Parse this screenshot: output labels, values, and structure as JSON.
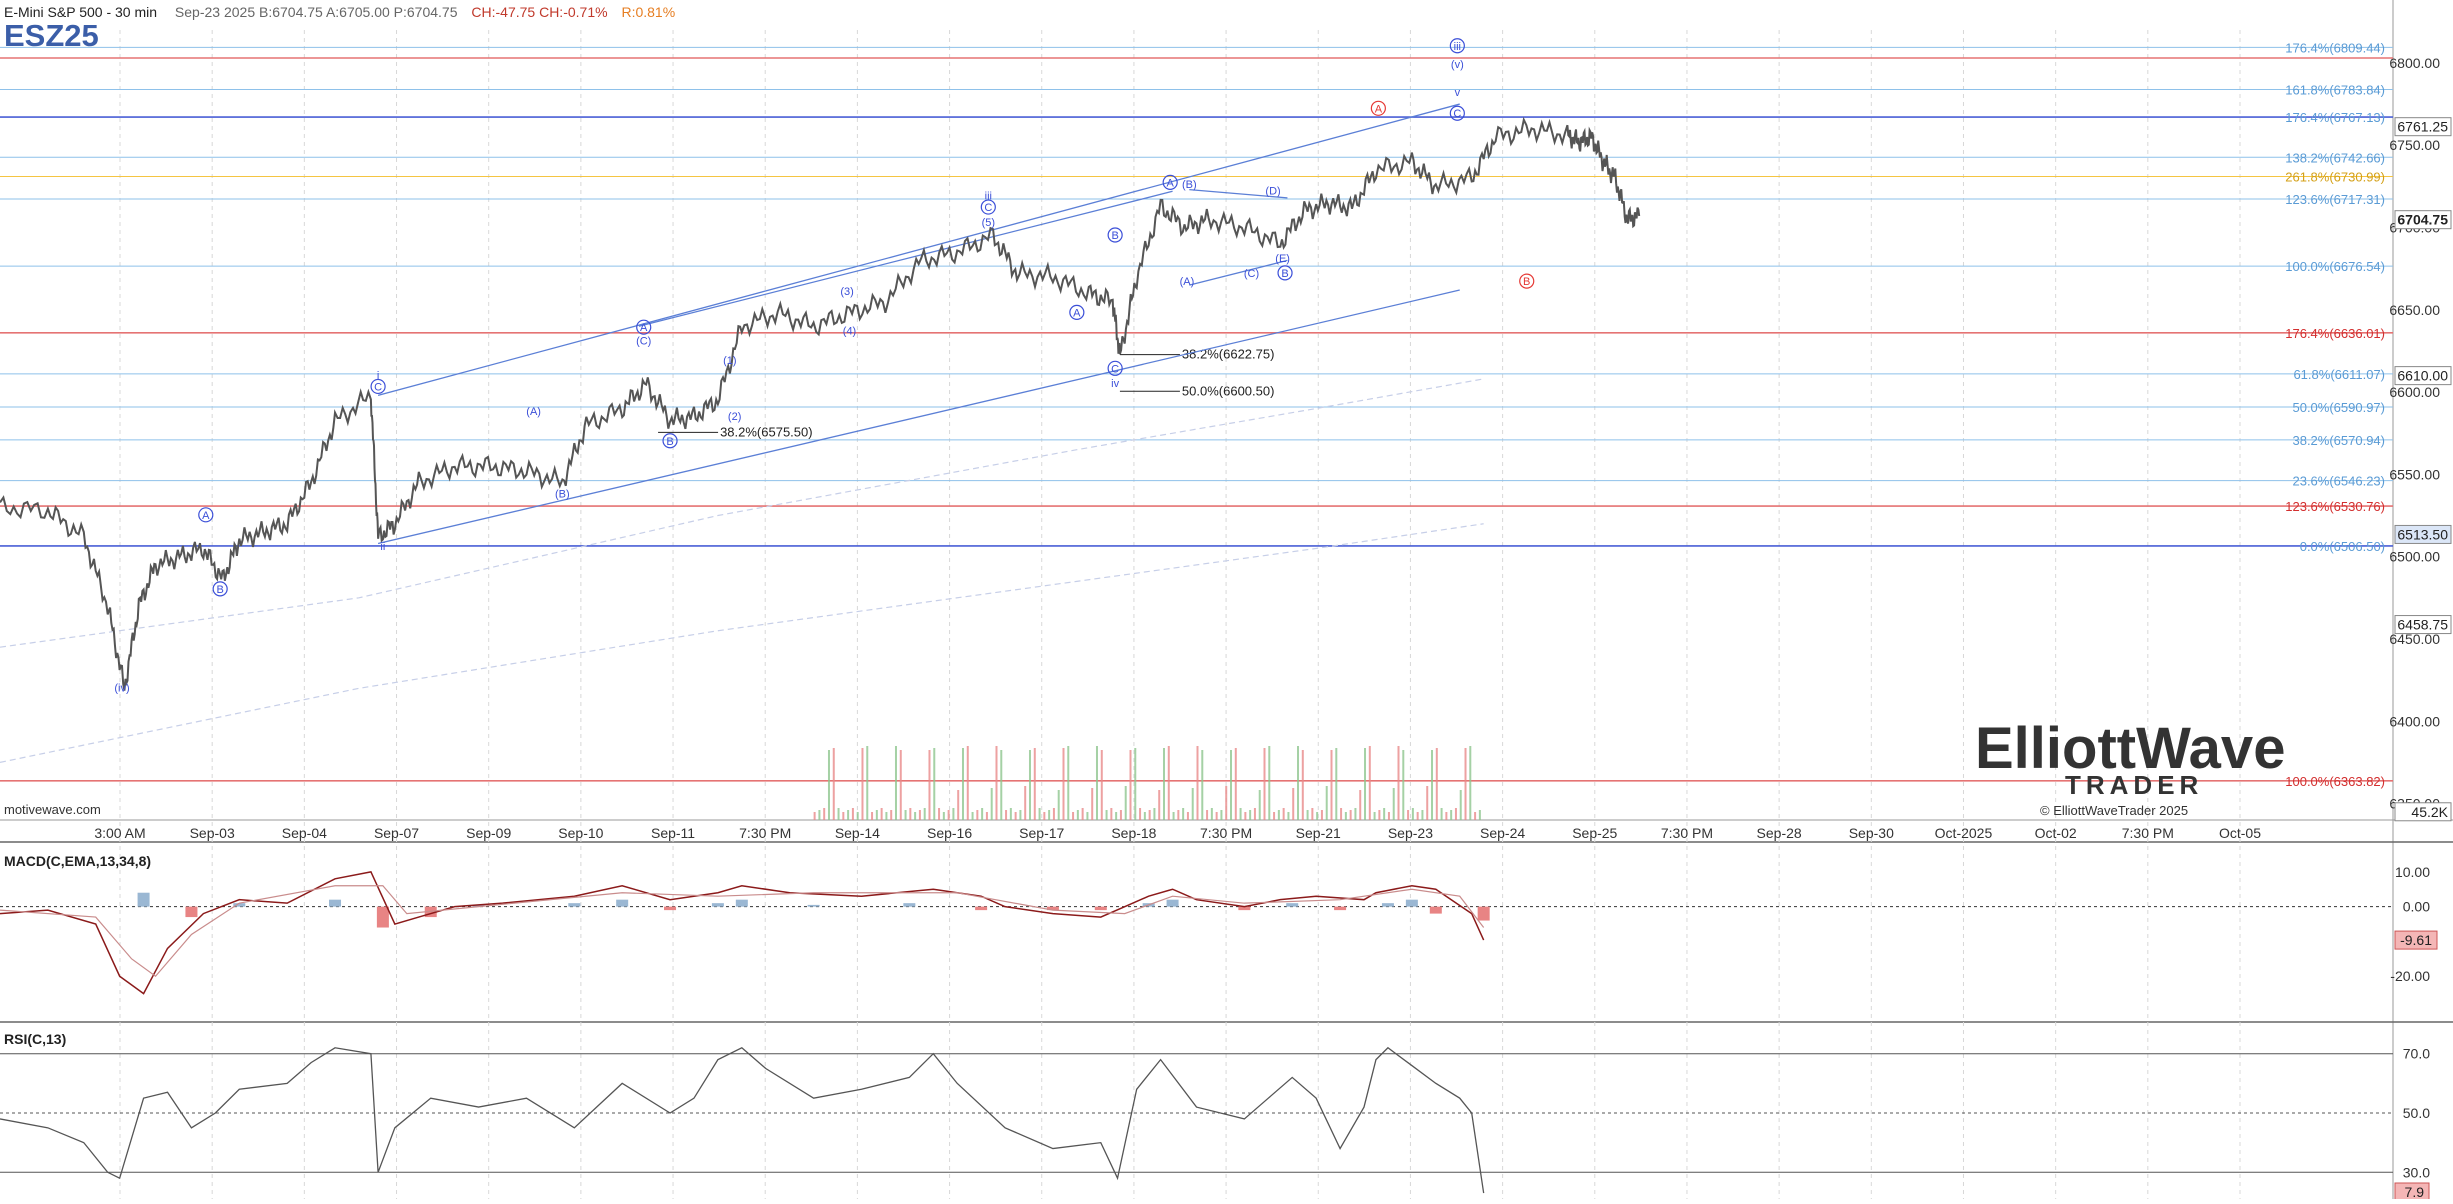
{
  "header": {
    "title": "E-Mini S&P 500 - 30 min",
    "quote": "Sep-23 2025  B:6704.75  A:6705.00  P:6704.75",
    "change": "CH:-47.75  CH:-0.71%",
    "range": "R:0.81%",
    "symbol": "ESZ25"
  },
  "watermark": {
    "source": "motivewave.com",
    "copyright": "© ElliottWaveTrader 2025",
    "logo_top": "ElliottWave",
    "logo_bottom": "TRADER"
  },
  "colors": {
    "price": "#555555",
    "fib_blue": "#8ec1ea",
    "fib_red": "#e57373",
    "channel": "#5b7fd6",
    "wave": "#3b4fd8",
    "wave_red": "#e53935",
    "macd_pos": "#9ab7d3",
    "macd_neg": "#e88484",
    "rsi": "#555555",
    "yellow": "#f5c542"
  },
  "chart_data": [
    {
      "type": "line",
      "title": "E-Mini S&P 500 - 30 min",
      "ylim": [
        6340,
        6820
      ],
      "y_ticks": [
        6800,
        6750,
        6700,
        6650,
        6600,
        6550,
        6500,
        6450,
        6400,
        6350
      ],
      "y_tick_labels": [
        "6800.00",
        "6750.00",
        "6700.00",
        "6650.00",
        "6600.00",
        "6550.00",
        "6500.00",
        "6450.00",
        "6400.00",
        "6350.00"
      ],
      "x_labels": [
        "3:00 AM",
        "Sep-03",
        "Sep-04",
        "Sep-07",
        "Sep-09",
        "Sep-10",
        "Sep-11",
        "7:30 PM",
        "Sep-14",
        "Sep-16",
        "Sep-17",
        "Sep-18",
        "7:30 PM",
        "Sep-21",
        "Sep-23",
        "Sep-24",
        "Sep-25",
        "7:30 PM",
        "Sep-28",
        "Sep-30",
        "Oct-2025",
        "Oct-02",
        "7:30 PM",
        "Oct-05"
      ],
      "price_path": [
        [
          0,
          6530
        ],
        [
          0.02,
          6528
        ],
        [
          0.035,
          6512
        ],
        [
          0.045,
          6470
        ],
        [
          0.052,
          6420
        ],
        [
          0.058,
          6470
        ],
        [
          0.065,
          6495
        ],
        [
          0.075,
          6500
        ],
        [
          0.085,
          6505
        ],
        [
          0.093,
          6486
        ],
        [
          0.1,
          6510
        ],
        [
          0.11,
          6515
        ],
        [
          0.12,
          6520
        ],
        [
          0.13,
          6545
        ],
        [
          0.14,
          6582
        ],
        [
          0.155,
          6598
        ],
        [
          0.158,
          6512
        ],
        [
          0.165,
          6520
        ],
        [
          0.175,
          6545
        ],
        [
          0.19,
          6555
        ],
        [
          0.205,
          6555
        ],
        [
          0.22,
          6552
        ],
        [
          0.235,
          6545
        ],
        [
          0.245,
          6580
        ],
        [
          0.26,
          6590
        ],
        [
          0.27,
          6605
        ],
        [
          0.28,
          6583
        ],
        [
          0.29,
          6585
        ],
        [
          0.3,
          6595
        ],
        [
          0.31,
          6640
        ],
        [
          0.325,
          6648
        ],
        [
          0.34,
          6640
        ],
        [
          0.355,
          6648
        ],
        [
          0.37,
          6655
        ],
        [
          0.385,
          6680
        ],
        [
          0.4,
          6685
        ],
        [
          0.415,
          6695
        ],
        [
          0.425,
          6672
        ],
        [
          0.44,
          6670
        ],
        [
          0.455,
          6660
        ],
        [
          0.465,
          6655
        ],
        [
          0.468,
          6622
        ],
        [
          0.475,
          6670
        ],
        [
          0.485,
          6713
        ],
        [
          0.495,
          6700
        ],
        [
          0.505,
          6705
        ],
        [
          0.52,
          6700
        ],
        [
          0.535,
          6690
        ],
        [
          0.545,
          6710
        ],
        [
          0.555,
          6715
        ],
        [
          0.565,
          6712
        ],
        [
          0.575,
          6735
        ],
        [
          0.59,
          6740
        ],
        [
          0.6,
          6725
        ],
        [
          0.615,
          6730
        ],
        [
          0.625,
          6755
        ],
        [
          0.64,
          6760
        ],
        [
          0.655,
          6756
        ],
        [
          0.66,
          6752
        ],
        [
          0.665,
          6755
        ],
        [
          0.67,
          6740
        ],
        [
          0.675,
          6730
        ],
        [
          0.68,
          6705
        ],
        [
          0.685,
          6707
        ]
      ],
      "fib_right": [
        {
          "label": "176.4%(6809.44)",
          "value": 6809.44,
          "color": "blue"
        },
        {
          "label": "161.8%(6783.84)",
          "value": 6783.84,
          "color": "blue"
        },
        {
          "label": "176.4%(6767.13)",
          "value": 6767.13,
          "color": "blue"
        },
        {
          "label": "138.2%(6742.66)",
          "value": 6742.66,
          "color": "blue"
        },
        {
          "label": "261.8%(6730.99)",
          "value": 6730.99,
          "color": "yellow"
        },
        {
          "label": "123.6%(6717.31)",
          "value": 6717.31,
          "color": "blue"
        },
        {
          "label": "100.0%(6676.54)",
          "value": 6676.54,
          "color": "blue"
        },
        {
          "label": "176.4%(6636.01)",
          "value": 6636.01,
          "color": "red"
        },
        {
          "label": "61.8%(6611.07)",
          "value": 6611.07,
          "color": "blue"
        },
        {
          "label": "50.0%(6590.97)",
          "value": 6590.97,
          "color": "blue"
        },
        {
          "label": "38.2%(6570.94)",
          "value": 6570.94,
          "color": "blue"
        },
        {
          "label": "23.6%(6546.23)",
          "value": 6546.23,
          "color": "blue"
        },
        {
          "label": "123.6%(6530.76)",
          "value": 6530.76,
          "color": "red"
        },
        {
          "label": "0.0%(6506.50)",
          "value": 6506.5,
          "color": "blue"
        },
        {
          "label": "100.0%(6363.82)",
          "value": 6363.82,
          "color": "red"
        }
      ],
      "fib_inline": [
        {
          "label": "38.2%(6575.50)",
          "value": 6575.5
        },
        {
          "label": "38.2%(6622.75)",
          "value": 6622.75
        },
        {
          "label": "50.0%(6600.50)",
          "value": 6600.5
        }
      ],
      "price_tags": [
        {
          "label": "6761.25",
          "value": 6761.25
        },
        {
          "label": "6704.75",
          "value": 6704.75
        },
        {
          "label": "6610.00",
          "value": 6610
        },
        {
          "label": "6513.50",
          "value": 6513.5
        },
        {
          "label": "6458.75",
          "value": 6458.75
        },
        {
          "label": "45.2K",
          "value": 6345
        }
      ],
      "wave_labels": [
        {
          "t": "(iv)",
          "x": 0.051,
          "y": 6418,
          "circle": false
        },
        {
          "t": "A",
          "x": 0.086,
          "y": 6523,
          "circle": true
        },
        {
          "t": "B",
          "x": 0.092,
          "y": 6478,
          "circle": true
        },
        {
          "t": "i",
          "x": 0.158,
          "y": 6608,
          "circle": false
        },
        {
          "t": "C",
          "x": 0.158,
          "y": 6601,
          "circle": true
        },
        {
          "t": "ii",
          "x": 0.16,
          "y": 6504,
          "circle": false
        },
        {
          "t": "(A)",
          "x": 0.223,
          "y": 6586,
          "circle": false
        },
        {
          "t": "(B)",
          "x": 0.235,
          "y": 6536,
          "circle": false
        },
        {
          "t": "A",
          "x": 0.269,
          "y": 6637,
          "circle": true
        },
        {
          "t": "(C)",
          "x": 0.269,
          "y": 6629,
          "circle": false
        },
        {
          "t": "B",
          "x": 0.28,
          "y": 6568,
          "circle": true
        },
        {
          "t": "(1)",
          "x": 0.305,
          "y": 6617,
          "circle": false
        },
        {
          "t": "(2)",
          "x": 0.307,
          "y": 6583,
          "circle": false
        },
        {
          "t": "(3)",
          "x": 0.354,
          "y": 6659,
          "circle": false
        },
        {
          "t": "(4)",
          "x": 0.355,
          "y": 6635,
          "circle": false
        },
        {
          "t": "iii",
          "x": 0.413,
          "y": 6717,
          "circle": false
        },
        {
          "t": "C",
          "x": 0.413,
          "y": 6710,
          "circle": true
        },
        {
          "t": "(5)",
          "x": 0.413,
          "y": 6701,
          "circle": false
        },
        {
          "t": "A",
          "x": 0.45,
          "y": 6646,
          "circle": true
        },
        {
          "t": "B",
          "x": 0.466,
          "y": 6693,
          "circle": true
        },
        {
          "t": "C",
          "x": 0.466,
          "y": 6612,
          "circle": true
        },
        {
          "t": "iv",
          "x": 0.466,
          "y": 6603,
          "circle": false
        },
        {
          "t": "A",
          "x": 0.489,
          "y": 6725,
          "circle": true
        },
        {
          "t": "(B)",
          "x": 0.497,
          "y": 6724,
          "circle": false
        },
        {
          "t": "(A)",
          "x": 0.496,
          "y": 6665,
          "circle": false
        },
        {
          "t": "(C)",
          "x": 0.523,
          "y": 6670,
          "circle": false
        },
        {
          "t": "(D)",
          "x": 0.532,
          "y": 6720,
          "circle": false
        },
        {
          "t": "(E)",
          "x": 0.536,
          "y": 6679,
          "circle": false
        },
        {
          "t": "B",
          "x": 0.537,
          "y": 6670,
          "circle": true
        },
        {
          "t": "A",
          "x": 0.576,
          "y": 6770,
          "circle": true,
          "red": true
        },
        {
          "t": "iii",
          "x": 0.609,
          "y": 6808,
          "circle": true
        },
        {
          "t": "(v)",
          "x": 0.609,
          "y": 6797,
          "circle": false
        },
        {
          "t": "v",
          "x": 0.609,
          "y": 6780,
          "circle": false
        },
        {
          "t": "C",
          "x": 0.609,
          "y": 6767,
          "circle": true
        },
        {
          "t": "B",
          "x": 0.638,
          "y": 6665,
          "circle": true,
          "red": true
        }
      ]
    },
    {
      "type": "bar",
      "title": "MACD(C,EMA,13,34,8)",
      "ylim": [
        -32,
        18
      ],
      "y_tick_labels": [
        "10.00",
        "0.00",
        "-20.00"
      ],
      "y_ticks": [
        10,
        0,
        -20
      ],
      "current_label": "-9.61",
      "current_value": -9.61,
      "macd_line": [
        [
          0,
          -2
        ],
        [
          0.02,
          -1
        ],
        [
          0.04,
          -5
        ],
        [
          0.05,
          -20
        ],
        [
          0.06,
          -25
        ],
        [
          0.07,
          -12
        ],
        [
          0.085,
          -2
        ],
        [
          0.1,
          2
        ],
        [
          0.12,
          1
        ],
        [
          0.14,
          8
        ],
        [
          0.155,
          10
        ],
        [
          0.165,
          -5
        ],
        [
          0.175,
          -3
        ],
        [
          0.19,
          0
        ],
        [
          0.21,
          1
        ],
        [
          0.24,
          3
        ],
        [
          0.26,
          6
        ],
        [
          0.28,
          2
        ],
        [
          0.3,
          4
        ],
        [
          0.31,
          6
        ],
        [
          0.33,
          4
        ],
        [
          0.36,
          3
        ],
        [
          0.39,
          5
        ],
        [
          0.41,
          3
        ],
        [
          0.42,
          0
        ],
        [
          0.44,
          -2
        ],
        [
          0.46,
          -3
        ],
        [
          0.47,
          0
        ],
        [
          0.48,
          3
        ],
        [
          0.49,
          5
        ],
        [
          0.5,
          2
        ],
        [
          0.52,
          0
        ],
        [
          0.535,
          2
        ],
        [
          0.55,
          3
        ],
        [
          0.57,
          2
        ],
        [
          0.575,
          4
        ],
        [
          0.59,
          6
        ],
        [
          0.6,
          5
        ],
        [
          0.615,
          -2
        ],
        [
          0.62,
          -9.6
        ]
      ],
      "signal_line": [
        [
          0,
          -1
        ],
        [
          0.04,
          -3
        ],
        [
          0.055,
          -15
        ],
        [
          0.065,
          -20
        ],
        [
          0.08,
          -8
        ],
        [
          0.1,
          1
        ],
        [
          0.14,
          6
        ],
        [
          0.16,
          6
        ],
        [
          0.17,
          -2
        ],
        [
          0.2,
          0
        ],
        [
          0.26,
          4
        ],
        [
          0.3,
          3
        ],
        [
          0.34,
          4
        ],
        [
          0.4,
          4
        ],
        [
          0.44,
          -1
        ],
        [
          0.47,
          -2
        ],
        [
          0.49,
          3
        ],
        [
          0.52,
          1
        ],
        [
          0.56,
          2
        ],
        [
          0.59,
          5
        ],
        [
          0.61,
          3
        ],
        [
          0.62,
          -6
        ]
      ],
      "histogram": [
        [
          0.06,
          4
        ],
        [
          0.08,
          -3
        ],
        [
          0.1,
          1
        ],
        [
          0.14,
          2
        ],
        [
          0.16,
          -6
        ],
        [
          0.18,
          -3
        ],
        [
          0.2,
          0.5
        ],
        [
          0.24,
          1
        ],
        [
          0.26,
          2
        ],
        [
          0.28,
          -1
        ],
        [
          0.3,
          1
        ],
        [
          0.31,
          2
        ],
        [
          0.34,
          0.5
        ],
        [
          0.38,
          1
        ],
        [
          0.41,
          -1
        ],
        [
          0.44,
          -1
        ],
        [
          0.46,
          -1
        ],
        [
          0.48,
          1
        ],
        [
          0.49,
          2
        ],
        [
          0.52,
          -1
        ],
        [
          0.54,
          1
        ],
        [
          0.56,
          -1
        ],
        [
          0.58,
          1
        ],
        [
          0.59,
          2
        ],
        [
          0.6,
          -2
        ],
        [
          0.62,
          -4
        ]
      ]
    },
    {
      "type": "line",
      "title": "RSI(C,13)",
      "ylim": [
        22,
        78
      ],
      "y_tick_labels": [
        "70.0",
        "50.0",
        "30.0"
      ],
      "y_ticks": [
        70,
        50,
        30
      ],
      "current_label": "7.9",
      "current_value": 7.9,
      "rsi_line": [
        [
          0,
          48
        ],
        [
          0.02,
          45
        ],
        [
          0.035,
          40
        ],
        [
          0.045,
          30
        ],
        [
          0.05,
          28
        ],
        [
          0.06,
          55
        ],
        [
          0.07,
          57
        ],
        [
          0.08,
          45
        ],
        [
          0.09,
          50
        ],
        [
          0.1,
          58
        ],
        [
          0.12,
          60
        ],
        [
          0.13,
          67
        ],
        [
          0.14,
          72
        ],
        [
          0.155,
          70
        ],
        [
          0.158,
          30
        ],
        [
          0.165,
          45
        ],
        [
          0.18,
          55
        ],
        [
          0.2,
          52
        ],
        [
          0.22,
          55
        ],
        [
          0.24,
          45
        ],
        [
          0.26,
          60
        ],
        [
          0.28,
          50
        ],
        [
          0.29,
          55
        ],
        [
          0.3,
          68
        ],
        [
          0.31,
          72
        ],
        [
          0.32,
          65
        ],
        [
          0.34,
          55
        ],
        [
          0.36,
          58
        ],
        [
          0.38,
          62
        ],
        [
          0.39,
          70
        ],
        [
          0.4,
          60
        ],
        [
          0.42,
          45
        ],
        [
          0.44,
          38
        ],
        [
          0.46,
          40
        ],
        [
          0.467,
          28
        ],
        [
          0.475,
          58
        ],
        [
          0.485,
          68
        ],
        [
          0.5,
          52
        ],
        [
          0.52,
          48
        ],
        [
          0.53,
          55
        ],
        [
          0.54,
          62
        ],
        [
          0.55,
          55
        ],
        [
          0.56,
          38
        ],
        [
          0.57,
          52
        ],
        [
          0.575,
          68
        ],
        [
          0.58,
          72
        ],
        [
          0.59,
          66
        ],
        [
          0.6,
          60
        ],
        [
          0.61,
          55
        ],
        [
          0.615,
          50
        ],
        [
          0.62,
          8
        ]
      ]
    }
  ]
}
